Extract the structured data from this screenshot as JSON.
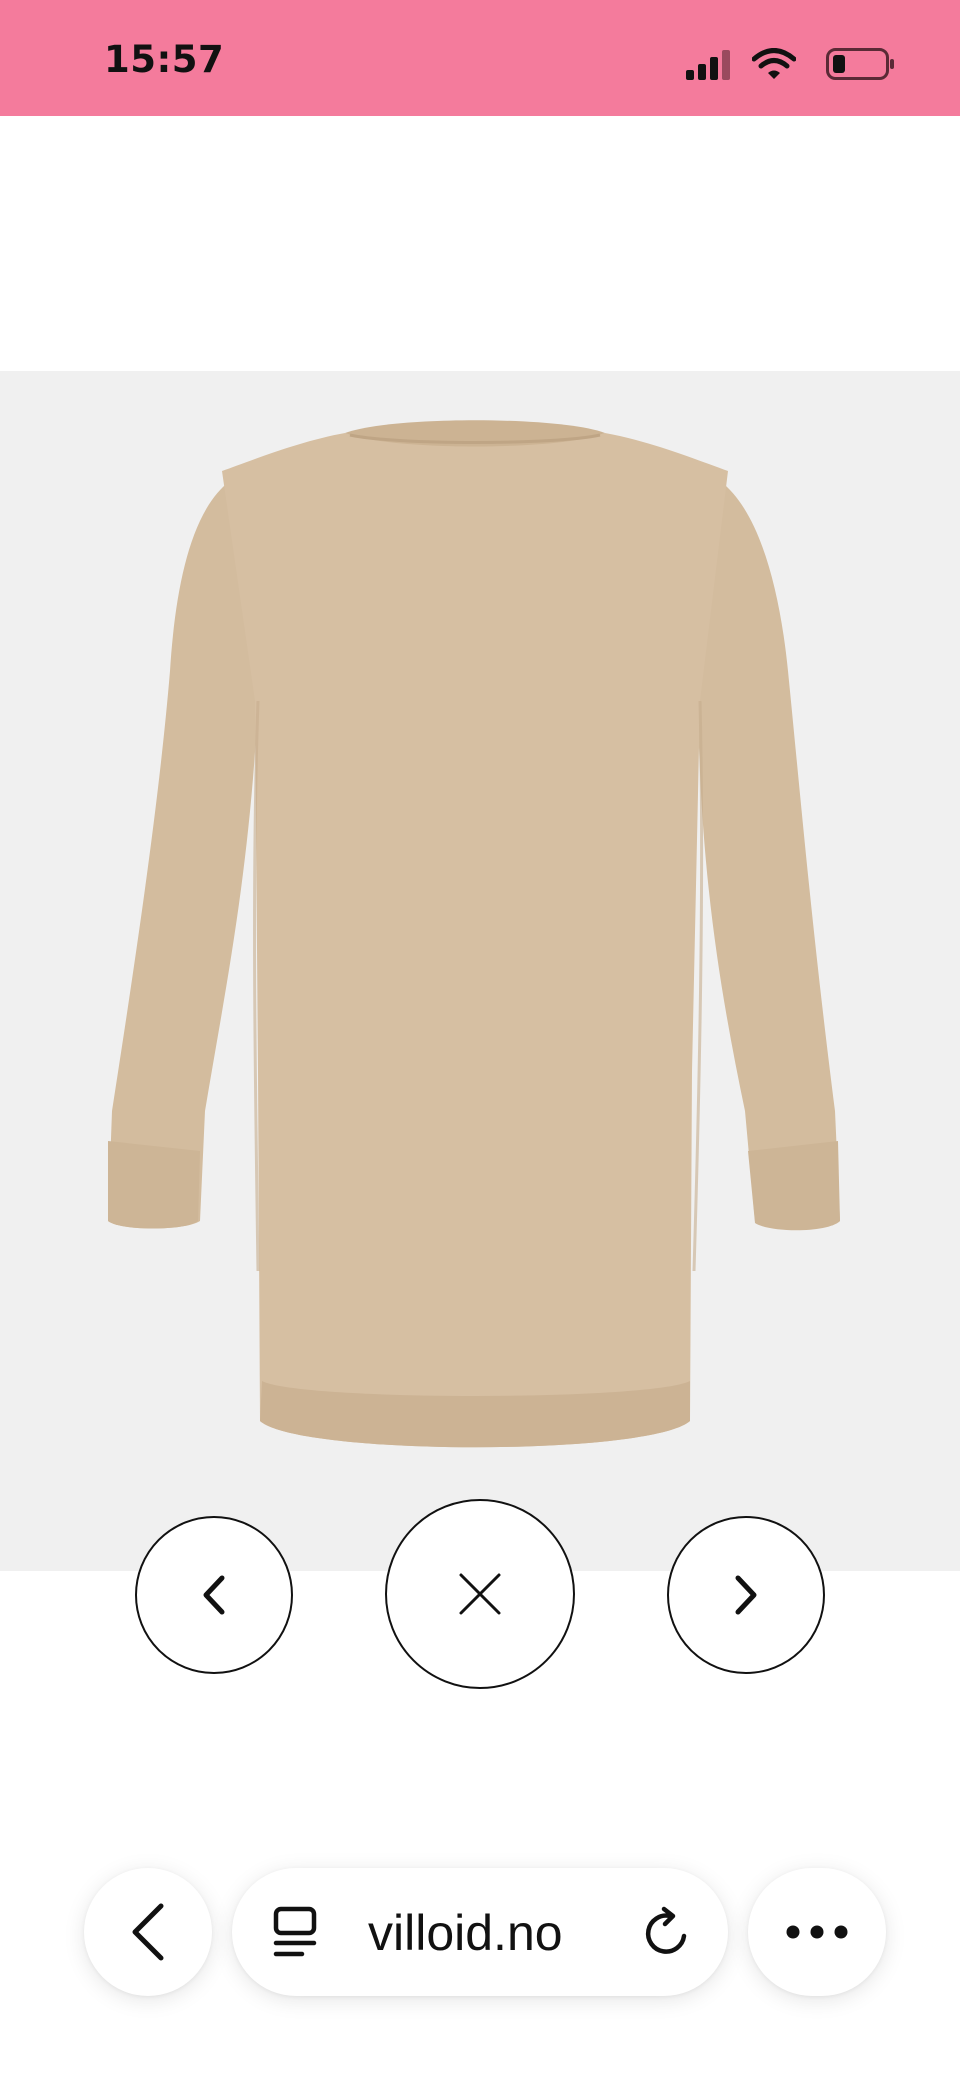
{
  "status_bar": {
    "time": "15:57",
    "background": "#f47b9c",
    "icons": [
      "cellular-signal-icon",
      "wifi-icon",
      "battery-low-icon"
    ],
    "battery_level": 0.2
  },
  "gallery": {
    "image": "beige-oversized-sweatshirt-dress-back-view",
    "prev_icon": "chevron-left-icon",
    "close_icon": "close-icon",
    "next_icon": "chevron-right-icon"
  },
  "browser": {
    "url": "villoid.no",
    "back_icon": "chevron-left-icon",
    "reader_icon": "reader-mode-icon",
    "reload_icon": "reload-icon",
    "more_icon": "more-icon"
  }
}
